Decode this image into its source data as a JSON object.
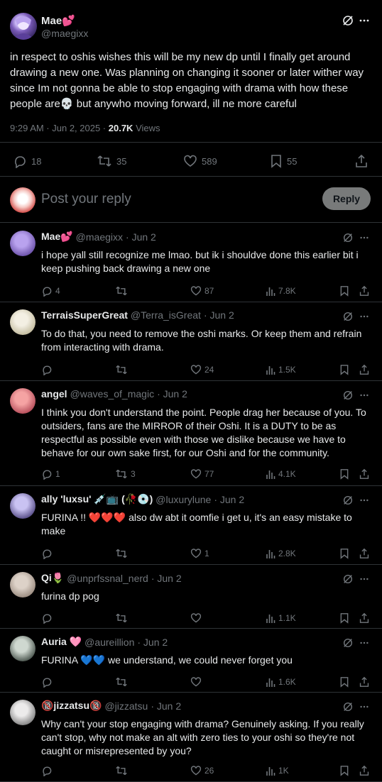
{
  "main_tweet": {
    "author_name": "Mae💕",
    "handle": "@maegixx",
    "text": "in respect to oshis wishes this will be my new dp until I finally get around drawing a new one. Was planning on changing it sooner or later wither way since Im not gonna be able to stop engaging with drama with how these people are💀 but anywho moving forward, ill ne more careful",
    "time": "9:29 AM · Jun 2, 2025 · ",
    "views_count": "20.7K",
    "views_label": "Views",
    "replies": "18",
    "reposts": "35",
    "likes": "589",
    "bookmarks": "55"
  },
  "reply_box": {
    "placeholder": "Post your reply",
    "button_label": "Reply"
  },
  "replies": [
    {
      "name": "Mae💕",
      "handle": "@maegixx",
      "date": "· Jun 2",
      "text": "i hope yall still recognize me lmao. but ik i shouldve done this earlier bit i keep pushing back drawing a new one",
      "replies": "4",
      "reposts": "",
      "likes": "87",
      "views": "7.8K"
    },
    {
      "name": "TerraisSuperGreat",
      "handle": "@Terra_isGreat",
      "date": "· Jun 2",
      "text": "To do that, you need to remove the oshi marks. Or keep them and refrain from interacting with drama.",
      "replies": "",
      "reposts": "",
      "likes": "24",
      "views": "1.5K"
    },
    {
      "name": "angel",
      "handle": "@waves_of_magic",
      "date": "· Jun 2",
      "text": "I think you don't understand the point.  People drag her because of you. To outsiders, fans are the MIRROR of their Oshi. It is a DUTY to be as respectful as possible even with those we dislike because we have to behave for our own sake first, for our Oshi and for the community.",
      "replies": "1",
      "reposts": "3",
      "likes": "77",
      "views": "4.1K"
    },
    {
      "name": "ally 'luxsu' 💉📺 (🥀💿)",
      "handle": "@luxurylune",
      "date": "· Jun 2",
      "text": "FURINA !! ❤️❤️❤️ also dw abt it oomfie i get u, it's an easy mistake to make",
      "replies": "",
      "reposts": "",
      "likes": "1",
      "views": "2.8K"
    },
    {
      "name": "Qi🌷",
      "handle": "@unprfssnal_nerd",
      "date": "· Jun 2",
      "text": "furina dp pog",
      "replies": "",
      "reposts": "",
      "likes": "",
      "views": "1.1K"
    },
    {
      "name": "Auria 🩷",
      "handle": "@aureillion",
      "date": "· Jun 2",
      "text": "FURINA 💙💙 we understand, we could never forget you",
      "replies": "",
      "reposts": "",
      "likes": "",
      "views": "1.6K"
    },
    {
      "name": "🔞jizzatsu🔞",
      "handle": "@jizzatsu",
      "date": "· Jun 2",
      "text": "Why can't your stop engaging with drama? Genuinely asking. If you really can't stop, why not make an alt with zero ties to your oshi so they're not caught or misrepresented by you?",
      "replies": "",
      "reposts": "",
      "likes": "26",
      "views": "1K"
    }
  ],
  "colors": {
    "background": "#000000",
    "text": "#e7e9ea",
    "secondary": "#71767b",
    "divider": "#2f3336"
  }
}
